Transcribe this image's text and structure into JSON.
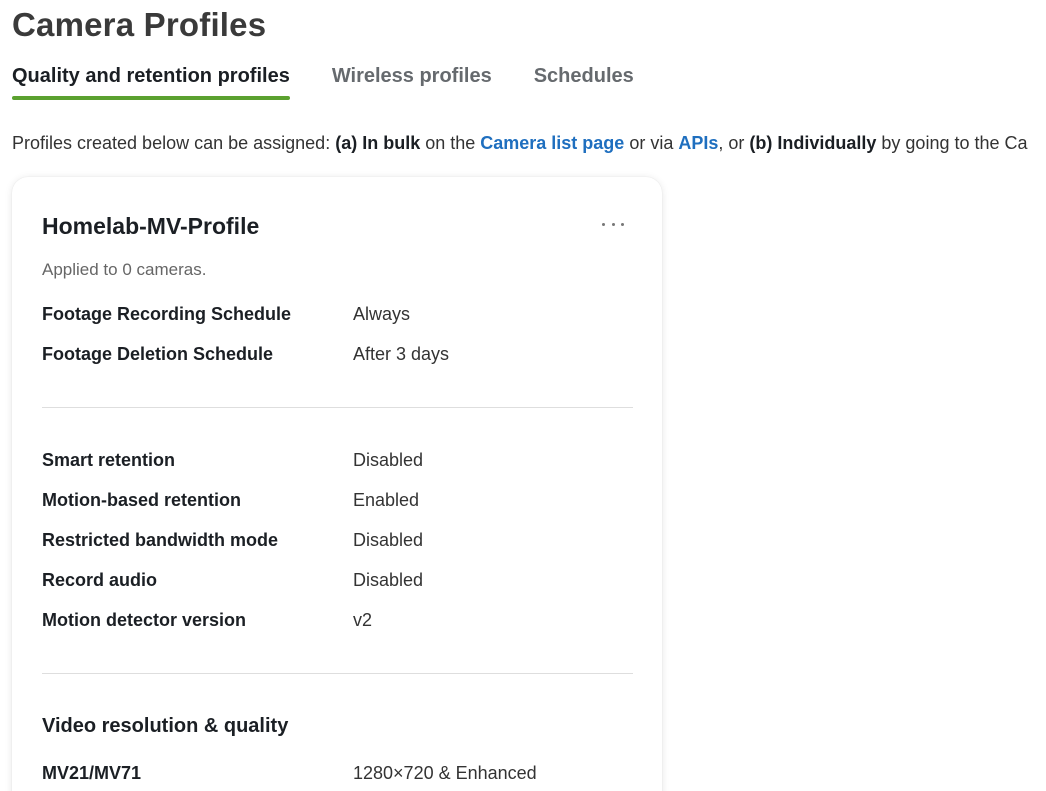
{
  "page": {
    "title": "Camera Profiles"
  },
  "tabs": [
    {
      "label": "Quality and retention profiles",
      "active": true
    },
    {
      "label": "Wireless profiles",
      "active": false
    },
    {
      "label": "Schedules",
      "active": false
    }
  ],
  "intro": {
    "text_1": "Profiles created below can be assigned: ",
    "bold_1": "(a) In bulk",
    "text_2": " on the ",
    "link_camera_list": "Camera list page",
    "text_3": " or via ",
    "link_apis": "APIs",
    "text_4": ", or ",
    "bold_2": "(b) Individually",
    "text_5": " by going to the Ca"
  },
  "profile": {
    "name": "Homelab-MV-Profile",
    "applied_text": "Applied to 0 cameras.",
    "more_icon": "ellipsis-icon",
    "schedule_rows": [
      {
        "label": "Footage Recording Schedule",
        "value": "Always"
      },
      {
        "label": "Footage Deletion Schedule",
        "value": "After 3 days"
      }
    ],
    "setting_rows": [
      {
        "label": "Smart retention",
        "value": "Disabled"
      },
      {
        "label": "Motion-based retention",
        "value": "Enabled"
      },
      {
        "label": "Restricted bandwidth mode",
        "value": "Disabled"
      },
      {
        "label": "Record audio",
        "value": "Disabled"
      },
      {
        "label": "Motion detector version",
        "value": "v2"
      }
    ],
    "video_section_title": "Video resolution & quality",
    "video_rows": [
      {
        "label": "MV21/MV71",
        "value": "1280×720 & Enhanced"
      }
    ]
  },
  "colors": {
    "active_tab_underline": "#5ba12f",
    "link": "#1f6fbf"
  }
}
